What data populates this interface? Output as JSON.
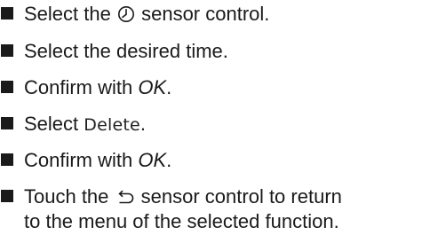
{
  "steps": [
    {
      "pre": "Select the",
      "post": "sensor control.",
      "icon": "clock-icon"
    },
    {
      "text": "Select the desired time."
    },
    {
      "pre": "Confirm with",
      "emph": "OK",
      "post": "."
    },
    {
      "pre": "Select",
      "ui": "Delete",
      "post": "."
    },
    {
      "pre": "Confirm with",
      "emph": "OK",
      "post": "."
    },
    {
      "pre": "Touch the",
      "post": "sensor control to return",
      "line2": "to the menu of the selected function.",
      "icon": "back-arrow-icon"
    }
  ]
}
